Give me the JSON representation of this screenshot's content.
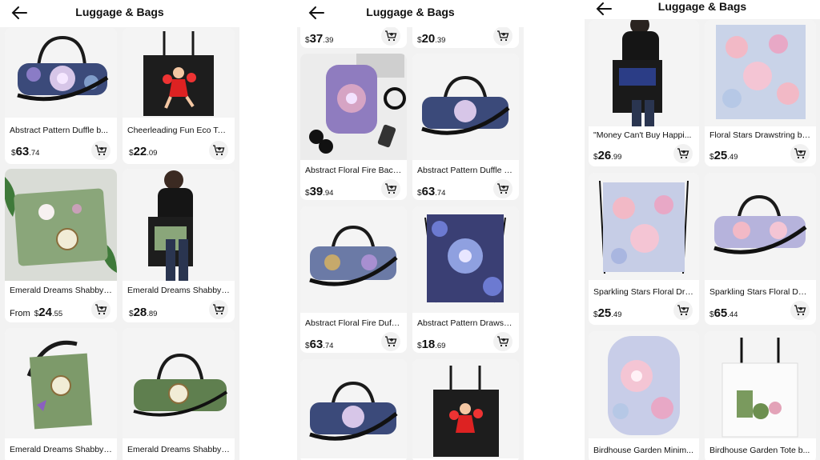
{
  "screens": [
    {
      "title": "Luggage & Bags",
      "products": [
        {
          "name": "Abstract Pattern Duffle b...",
          "from": "",
          "cur": "$",
          "dollars": "63",
          "cents": ".74",
          "image": "duffle-floral"
        },
        {
          "name": "Cheerleading Fun Eco Tot...",
          "from": "",
          "cur": "$",
          "dollars": "22",
          "cents": ".09",
          "image": "tote-cheerleader"
        },
        {
          "name": "Emerald Dreams Shabby ...",
          "from": "From ",
          "cur": "$",
          "dollars": "24",
          "cents": ".55",
          "image": "laptop-sleeve-green"
        },
        {
          "name": "Emerald Dreams Shabby ...",
          "from": "",
          "cur": "$",
          "dollars": "28",
          "cents": ".89",
          "image": "tote-model-green"
        },
        {
          "name": "Emerald Dreams Shabby ...",
          "from": "",
          "cur": "",
          "dollars": "",
          "cents": "",
          "image": "tote-green"
        },
        {
          "name": "Emerald Dreams Shabby ...",
          "from": "",
          "cur": "",
          "dollars": "",
          "cents": "",
          "image": "duffle-green"
        }
      ]
    },
    {
      "title": "Luggage & Bags",
      "products": [
        {
          "name": "",
          "from": "",
          "cur": "$",
          "dollars": "37",
          "cents": ".39",
          "image": ""
        },
        {
          "name": "",
          "from": "",
          "cur": "$",
          "dollars": "20",
          "cents": ".39",
          "image": ""
        },
        {
          "name": "Abstract Floral Fire Backp...",
          "from": "",
          "cur": "$",
          "dollars": "39",
          "cents": ".94",
          "image": "backpack-desk"
        },
        {
          "name": "Abstract Pattern Duffle b...",
          "from": "",
          "cur": "$",
          "dollars": "63",
          "cents": ".74",
          "image": "duffle-floral"
        },
        {
          "name": "Abstract Floral Fire Duffle...",
          "from": "",
          "cur": "$",
          "dollars": "63",
          "cents": ".74",
          "image": "duffle-stained"
        },
        {
          "name": "Abstract Pattern Drawstri...",
          "from": "",
          "cur": "$",
          "dollars": "18",
          "cents": ".69",
          "image": "drawstring-dark"
        },
        {
          "name": "",
          "from": "",
          "cur": "",
          "dollars": "",
          "cents": "",
          "image": "duffle-floral"
        },
        {
          "name": "",
          "from": "",
          "cur": "",
          "dollars": "",
          "cents": "",
          "image": "tote-cheerleader"
        }
      ]
    },
    {
      "title": "Luggage & Bags",
      "products": [
        {
          "name": "\"Money Can't Buy Happi...",
          "from": "",
          "cur": "$",
          "dollars": "26",
          "cents": ".99",
          "image": "tote-model-black"
        },
        {
          "name": "Floral Stars Drawstring bag",
          "from": "",
          "cur": "$",
          "dollars": "25",
          "cents": ".49",
          "image": "pastel-pattern"
        },
        {
          "name": "Sparkling Stars Floral Dra...",
          "from": "",
          "cur": "$",
          "dollars": "25",
          "cents": ".49",
          "image": "drawstring-pastel"
        },
        {
          "name": "Sparkling Stars Floral Duf...",
          "from": "",
          "cur": "$",
          "dollars": "65",
          "cents": ".44",
          "image": "duffle-pastel"
        },
        {
          "name": "Birdhouse Garden Minim...",
          "from": "",
          "cur": "",
          "dollars": "",
          "cents": "",
          "image": "backpack-pastel"
        },
        {
          "name": "Birdhouse Garden Tote b...",
          "from": "",
          "cur": "",
          "dollars": "",
          "cents": "",
          "image": "tote-white"
        }
      ]
    }
  ]
}
